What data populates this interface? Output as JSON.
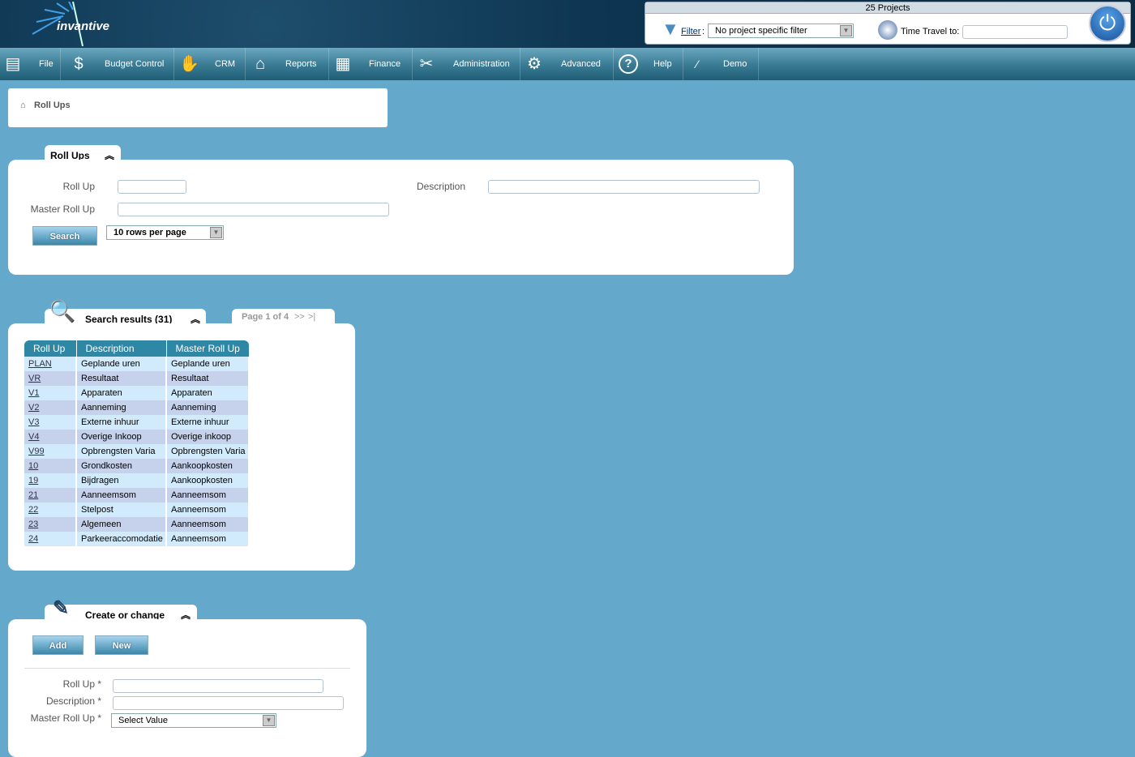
{
  "header": {
    "logo": "invantive",
    "projects": "25 Projects",
    "filter_label": "Filter",
    "filter_value": "No project specific filter",
    "time_travel_label": "Time Travel to:",
    "time_travel_value": ""
  },
  "nav": [
    {
      "label": "File",
      "icon": "file-cabinet-icon"
    },
    {
      "label": "Budget Control",
      "icon": "money-bag-icon"
    },
    {
      "label": "CRM",
      "icon": "handshake-icon"
    },
    {
      "label": "Reports",
      "icon": "chart-board-icon"
    },
    {
      "label": "Finance",
      "icon": "calculator-icon"
    },
    {
      "label": "Administration",
      "icon": "tools-icon"
    },
    {
      "label": "Advanced",
      "icon": "gears-icon"
    },
    {
      "label": "Help",
      "icon": "help-icon"
    },
    {
      "label": "Demo",
      "icon": "invantive-icon"
    }
  ],
  "breadcrumb": "Roll Ups",
  "search": {
    "tab": "Roll Ups",
    "roll_up_label": "Roll Up",
    "roll_up_value": "",
    "description_label": "Description",
    "description_value": "",
    "master_label": "Master Roll Up",
    "master_value": "",
    "button": "Search",
    "rows_per_page": "10 rows per page"
  },
  "results": {
    "tab": "Search results (31)",
    "pager": "Page 1 of 4",
    "next": ">>",
    "last": ">|",
    "columns": [
      "Roll Up",
      "Description",
      "Master Roll Up"
    ],
    "rows": [
      [
        "PLAN",
        "Geplande uren",
        "Geplande uren"
      ],
      [
        "VR",
        "Resultaat",
        "Resultaat"
      ],
      [
        "V1",
        "Apparaten",
        "Apparaten"
      ],
      [
        "V2",
        "Aanneming",
        "Aanneming"
      ],
      [
        "V3",
        "Externe inhuur",
        "Externe inhuur"
      ],
      [
        "V4",
        "Overige Inkoop",
        "Overige inkoop"
      ],
      [
        "V99",
        "Opbrengsten Varia",
        "Opbrengsten Varia"
      ],
      [
        "10",
        "Grondkosten",
        "Aankoopkosten"
      ],
      [
        "19",
        "Bijdragen",
        "Aankoopkosten"
      ],
      [
        "21",
        "Aanneemsom",
        "Aanneemsom"
      ],
      [
        "22",
        "Stelpost",
        "Aanneemsom"
      ],
      [
        "23",
        "Algemeen",
        "Aanneemsom"
      ],
      [
        "24",
        "Parkeeraccomodatie",
        "Aanneemsom"
      ]
    ]
  },
  "create": {
    "tab": "Create or change",
    "add": "Add",
    "new": "New",
    "roll_up_label": "Roll Up *",
    "description_label": "Description *",
    "master_label": "Master Roll Up *",
    "master_value": "Select Value"
  }
}
